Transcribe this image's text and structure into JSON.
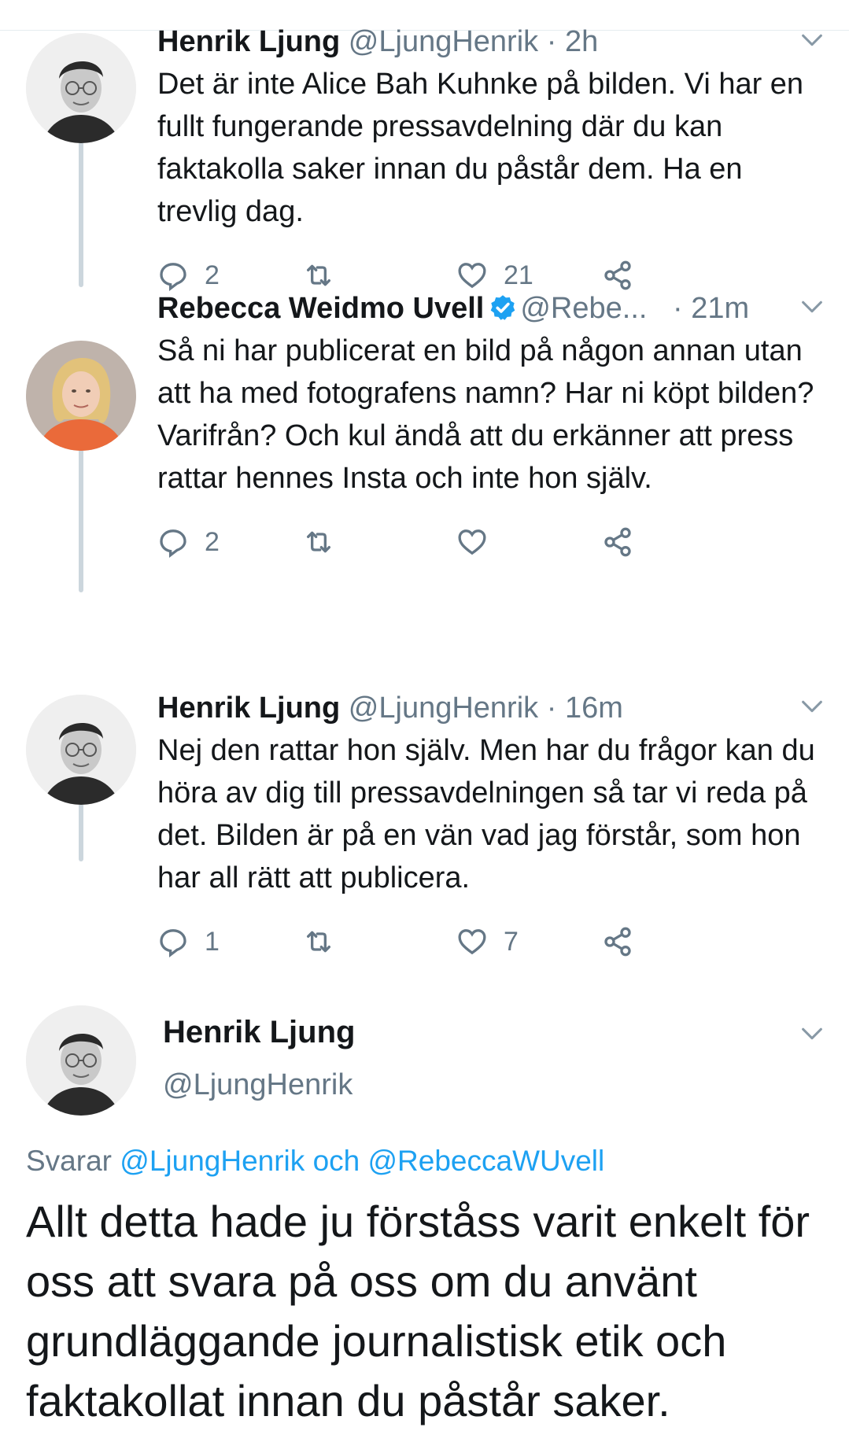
{
  "thread": [
    {
      "name": "Henrik Ljung",
      "handle": "@LjungHenrik",
      "separator": "·",
      "time": "2h",
      "verified": false,
      "text": "Det är inte Alice Bah Kuhnke på bilden. Vi har en fullt fungerande pressavdelning där du kan faktakolla saker innan du påstår dem. Ha en trevlig dag.",
      "replies": "2",
      "retweets": "",
      "likes": "21"
    },
    {
      "name": "Rebecca Weidmo Uvell",
      "handle": "@Rebe...",
      "separator": "·",
      "time": "21m",
      "verified": true,
      "text": "Så ni har publicerat en bild på någon annan utan att ha med fotografens namn? Har ni köpt bilden? Varifrån? Och kul ändå att du erkänner att press rattar hennes Insta och inte hon själv.",
      "replies": "2",
      "retweets": "",
      "likes": ""
    },
    {
      "name": "Henrik Ljung",
      "handle": "@LjungHenrik",
      "separator": "·",
      "time": "16m",
      "verified": false,
      "text": "Nej den rattar hon själv. Men har du frågor kan du höra av dig till pressavdelningen så tar vi reda på det. Bilden är på en vän vad jag förstår, som hon har all rätt att publicera.",
      "replies": "1",
      "retweets": "",
      "likes": "7"
    }
  ],
  "main_tweet": {
    "name": "Henrik Ljung",
    "handle": "@LjungHenrik",
    "replying_prefix": "Svarar",
    "mention_1": "@LjungHenrik",
    "conjunction": "och",
    "mention_2": "@RebeccaWUvell",
    "text": "Allt detta hade ju förståss varit enkelt för oss att svara på oss om du använt grundläggande journalistisk etik och faktakollat innan du påstår saker."
  },
  "icons": {
    "reply": "reply-icon",
    "retweet": "retweet-icon",
    "like": "heart-icon",
    "share": "share-icon",
    "more": "chevron-down-icon",
    "verified": "verified-badge-icon"
  },
  "colors": {
    "text": "#14171a",
    "secondary": "#657786",
    "accent": "#1da1f2",
    "thread_line": "#ccd6dd"
  }
}
